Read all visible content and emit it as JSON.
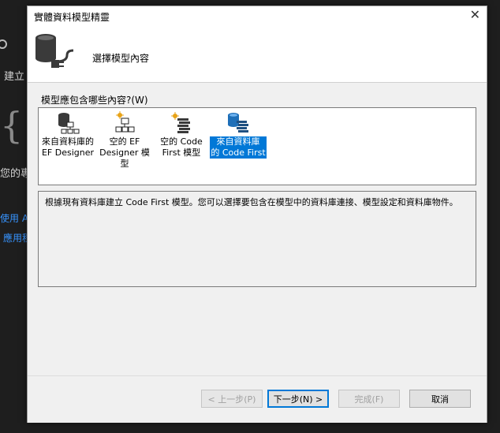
{
  "background": {
    "text_create": "建立",
    "text_your": "您的專",
    "link_use": "使用 A",
    "link_app": "應用程",
    "brace": "{"
  },
  "dialog": {
    "title": "實體資料模型精靈",
    "close_glyph": "✕",
    "header_text": "選擇模型內容",
    "question": "模型應包含哪些內容?(W)",
    "items": [
      {
        "label_line1": "來自資料庫的",
        "label_line2": "EF Designer",
        "label_line3": "",
        "icon": "database-hierarchy-icon",
        "selected": false
      },
      {
        "label_line1": "空的 EF",
        "label_line2": "Designer 模",
        "label_line3": "型",
        "icon": "hierarchy-sparkle-icon",
        "selected": false
      },
      {
        "label_line1": "空的 Code",
        "label_line2": "First 模型",
        "label_line3": "",
        "icon": "code-sparkle-icon",
        "selected": false
      },
      {
        "label_line1": "來自資料庫",
        "label_line2": "的 Code First",
        "label_line3": "",
        "icon": "database-code-icon",
        "selected": true
      }
    ],
    "description": "根據現有資料庫建立 Code First 模型。您可以選擇要包含在模型中的資料庫連接、模型設定和資料庫物件。",
    "buttons": {
      "prev": "< 上一步(P)",
      "next": "下一步(N) >",
      "finish": "完成(F)",
      "cancel": "取消"
    }
  },
  "colors": {
    "selection": "#0078d7",
    "link": "#3794ff",
    "ide_background": "#1e1e1e"
  }
}
